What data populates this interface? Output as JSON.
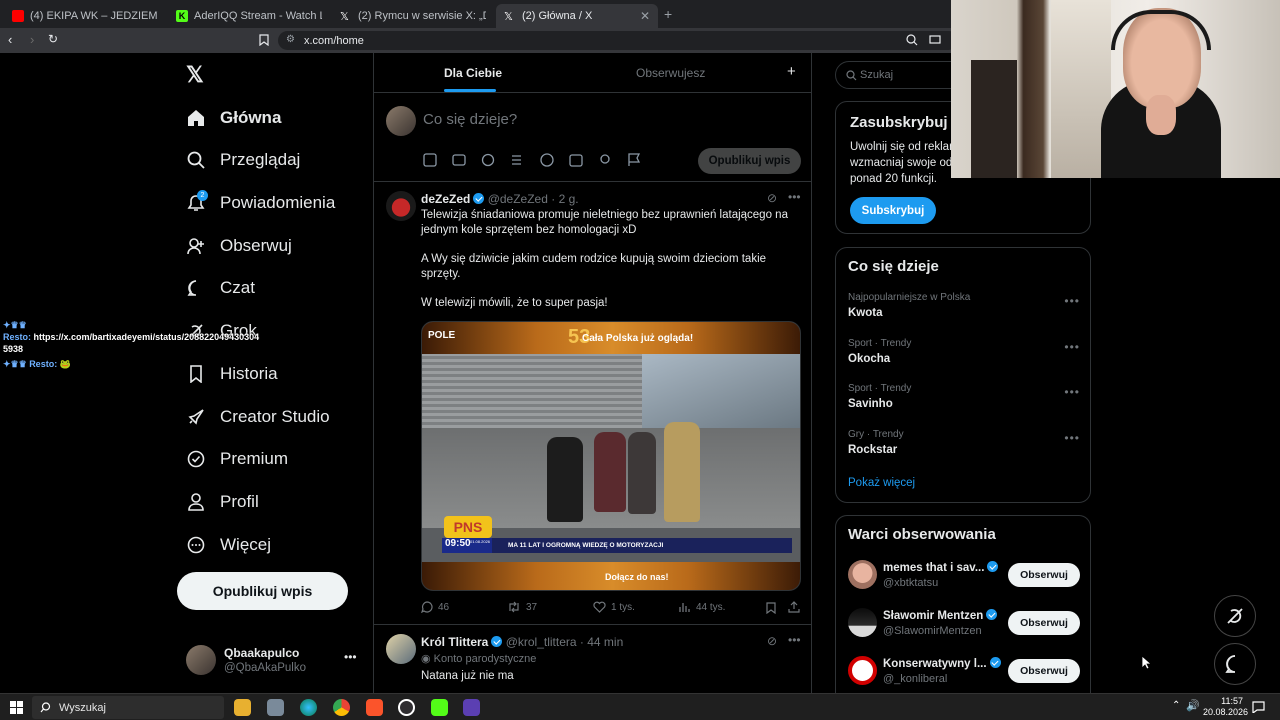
{
  "browser": {
    "tabs": [
      {
        "title": "(4) EKIPA WK – JEDZIEMY - YouTube",
        "color": "#ff0000"
      },
      {
        "title": "AderIQQ Stream - Watch Live on Kick",
        "color": "#53fc18"
      },
      {
        "title": "(2) Rymcu w serwisie X: „Dis - Mon",
        "color": "#ffffff"
      },
      {
        "title": "(2) Główna / X",
        "color": "#ffffff"
      }
    ],
    "url": "x.com/home"
  },
  "sidebar": {
    "nav": [
      {
        "label": "Główna",
        "icon": "home-icon"
      },
      {
        "label": "Przeglądaj",
        "icon": "search-icon"
      },
      {
        "label": "Powiadomienia",
        "icon": "bell-icon",
        "badge": "2"
      },
      {
        "label": "Obserwuj",
        "icon": "follow-icon"
      },
      {
        "label": "Czat",
        "icon": "chat-icon"
      },
      {
        "label": "Grok",
        "icon": "grok-icon"
      },
      {
        "label": "Historia",
        "icon": "bookmark-icon"
      },
      {
        "label": "Creator Studio",
        "icon": "rocket-icon"
      },
      {
        "label": "Premium",
        "icon": "premium-icon"
      },
      {
        "label": "Profil",
        "icon": "profile-icon"
      },
      {
        "label": "Więcej",
        "icon": "more-icon"
      }
    ],
    "post_button": "Opublikuj wpis",
    "account": {
      "name": "Qbaakapulco",
      "handle": "@QbaAkaPulko"
    }
  },
  "overlay_chat": {
    "line1_name": "Resto:",
    "line1_text": "https://x.com/bartixadeyemi/status/2088220494303045938",
    "line2_name": "Resto:"
  },
  "feed": {
    "tabs": [
      "Dla Ciebie",
      "Obserwujesz"
    ],
    "compose_placeholder": "Co się dzieje?",
    "compose_button": "Opublikuj wpis",
    "tweet1": {
      "name": "deZeZed",
      "handle": "@deZeZed",
      "time": "2 g.",
      "p1": "Telewizja śniadaniowa promuje nieletniego bez uprawnień latającego na jednym kole sprzętem bez homologacji xD",
      "p2": "A Wy się dziwicie jakim cudem rodzice kupują swoim dzieciom takie sprzęty.",
      "p3": "W telewizji mówili, że to super pasja!",
      "media": {
        "top_banner": "Cała Polska już ogląda!",
        "logo": "POLE",
        "logo_num": "53",
        "ticker": "MA 11 LAT I OGROMNĄ WIEDZĘ O MOTORYZACJI",
        "clock": "09:50",
        "clock_date": "01.08.2026",
        "show_logo": "PNS",
        "bottom_banner": "Dołącz do nas!"
      },
      "stats": {
        "replies": "46",
        "reposts": "37",
        "likes": "1 tys.",
        "views": "44 tys."
      }
    },
    "tweet2": {
      "name": "Król Tlittera",
      "handle": "@krol_tlittera",
      "time": "44 min",
      "label": "Konto parodystyczne",
      "text": "Natana już nie ma"
    }
  },
  "right": {
    "search_placeholder": "Szukaj",
    "subscribe": {
      "title": "Zasubskrybuj Premium",
      "line1": "Uwolnij się od reklam",
      "line2": "wzmacniaj swoje od",
      "line3": "ponad 20 funkcji.",
      "button": "Subskrybuj"
    },
    "trends_title": "Co się dzieje",
    "trends": [
      {
        "meta": "Najpopularniejsze w Polska",
        "name": "Kwota"
      },
      {
        "meta": "Sport · Trendy",
        "name": "Okocha"
      },
      {
        "meta": "Sport · Trendy",
        "name": "Savinho"
      },
      {
        "meta": "Gry · Trendy",
        "name": "Rockstar"
      }
    ],
    "show_more": "Pokaż więcej",
    "who_title": "Warci obserwowania",
    "who": [
      {
        "name": "memes that i sav...",
        "handle": "@xbtktatsu",
        "button": "Obserwuj"
      },
      {
        "name": "Sławomir Mentzen",
        "handle": "@SlawomirMentzen",
        "button": "Obserwuj"
      },
      {
        "name": "Konserwatywny l...",
        "handle": "@_konliberal",
        "button": "Obserwuj"
      }
    ]
  },
  "taskbar": {
    "search": "Wyszukaj",
    "time": "11:57",
    "date": "20.08.2026"
  }
}
